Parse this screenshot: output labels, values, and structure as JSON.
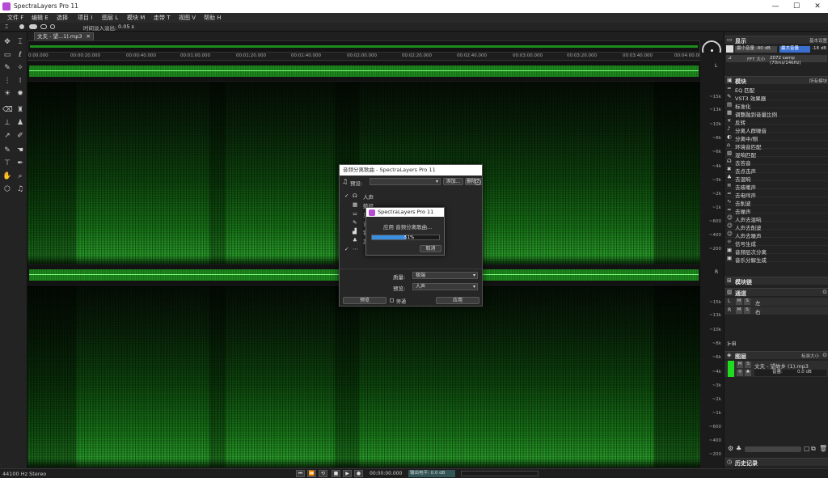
{
  "app": {
    "title": "SpectraLayers Pro 11"
  },
  "menu": [
    "文件 F",
    "编辑 E",
    "选择",
    "项目 I",
    "图层 L",
    "模块 M",
    "走带 T",
    "视图 V",
    "帮助 H"
  ],
  "options": {
    "fade_label": "时间淡入淡出:",
    "fade_value": "0.05 s"
  },
  "document": {
    "tab_label": "文夫 - 望...1).mp3"
  },
  "ruler": [
    "0:00.000",
    "00:00:20.000",
    "00:00:40.000",
    "00:01:00.000",
    "00:01:20.000",
    "00:01:40.000",
    "00:02:00.000",
    "00:02:20.000",
    "00:02:40.000",
    "00:03:00.000",
    "00:03:20.000",
    "00:03:40.000",
    "00:04:00.000"
  ],
  "freq_labels": [
    "~15k",
    "~13k",
    "~10k",
    "~8k",
    "~6k",
    "~4k",
    "~3k",
    "~2k",
    "~1k",
    "~600",
    "~400",
    "~200"
  ],
  "display_panel": {
    "title": "显示",
    "preset": "基本设置",
    "min_label": "最小音量",
    "min_value": "-90 dB",
    "max_label": "最大音量",
    "max_value": "-18 dB",
    "fft_label": "FFT 大小",
    "fft_value": "2072 samp (70ms/14kHz)"
  },
  "modules_panel": {
    "title": "模块",
    "filter": "所有模块",
    "items": [
      {
        "icon": "≈",
        "label": "EQ 匹配"
      },
      {
        "icon": "✎",
        "label": "VST3 效果器"
      },
      {
        "icon": "▤",
        "label": "标准化"
      },
      {
        "icon": "▦",
        "label": "调整融到音量比例"
      },
      {
        "icon": "✕",
        "label": "反转"
      },
      {
        "icon": "♪",
        "label": "分离人群噪音"
      },
      {
        "icon": "◐",
        "label": "分离中/侧"
      },
      {
        "icon": "⌂",
        "label": "环境音匹配"
      },
      {
        "icon": "▧",
        "label": "混响匹配"
      },
      {
        "icon": "☊",
        "label": "去答音"
      },
      {
        "icon": "✱",
        "label": "去点击声"
      },
      {
        "icon": "♣",
        "label": "去混响"
      },
      {
        "icon": "≋",
        "label": "去咳嗽声"
      },
      {
        "icon": "≈",
        "label": "去电哼声"
      },
      {
        "icon": "∿",
        "label": "去削波"
      },
      {
        "icon": "≈",
        "label": "去噪声"
      },
      {
        "icon": "☺",
        "label": "人声去混响"
      },
      {
        "icon": "☺",
        "label": "人声去削波"
      },
      {
        "icon": "☺",
        "label": "人声去噪声"
      },
      {
        "icon": "☼",
        "label": "信号生成"
      },
      {
        "icon": "▣",
        "label": "音频层次分离"
      },
      {
        "icon": "▣",
        "label": "音乐分解生成"
      }
    ],
    "footer": "模块链"
  },
  "channels_panel": {
    "title": "通道",
    "rows": [
      {
        "ch": "L",
        "m": "M",
        "s": "S",
        "name": "左"
      },
      {
        "ch": "R",
        "m": "M",
        "s": "S",
        "name": "右"
      }
    ]
  },
  "layers_panel": {
    "title": "图层",
    "size": "标准大小",
    "layer_name": "文夫 - 望故乡 (1).mp3",
    "gain_label": "音量:",
    "gain_value": "0.0 dB"
  },
  "history_panel": {
    "title": "历史记录"
  },
  "dialog": {
    "title": "音频分离歌曲 - SpectraLayers Pro 11",
    "preset_label": "预设:",
    "add_button": "添加...",
    "delete_button": "删除...",
    "help_button": "?",
    "stems": [
      "人声",
      "鼓组",
      "贝",
      "吉",
      "钢",
      "其"
    ],
    "quality_label": "质量:",
    "quality_value": "极端",
    "preview_label": "预览:",
    "preview_value": "人声",
    "preview_button": "预览",
    "fade_checkbox": "旁通",
    "apply_button": "应用"
  },
  "progress": {
    "title": "SpectraLayers Pro 11",
    "message": "应用 音频分离歌曲...",
    "percent": 51,
    "percent_label": "51%",
    "cancel_button": "取消"
  },
  "status": {
    "format": "44100 Hz Stereo",
    "time": "00:00:00.000",
    "output_label": "输出电平:",
    "output_value": "0.0 dB"
  }
}
